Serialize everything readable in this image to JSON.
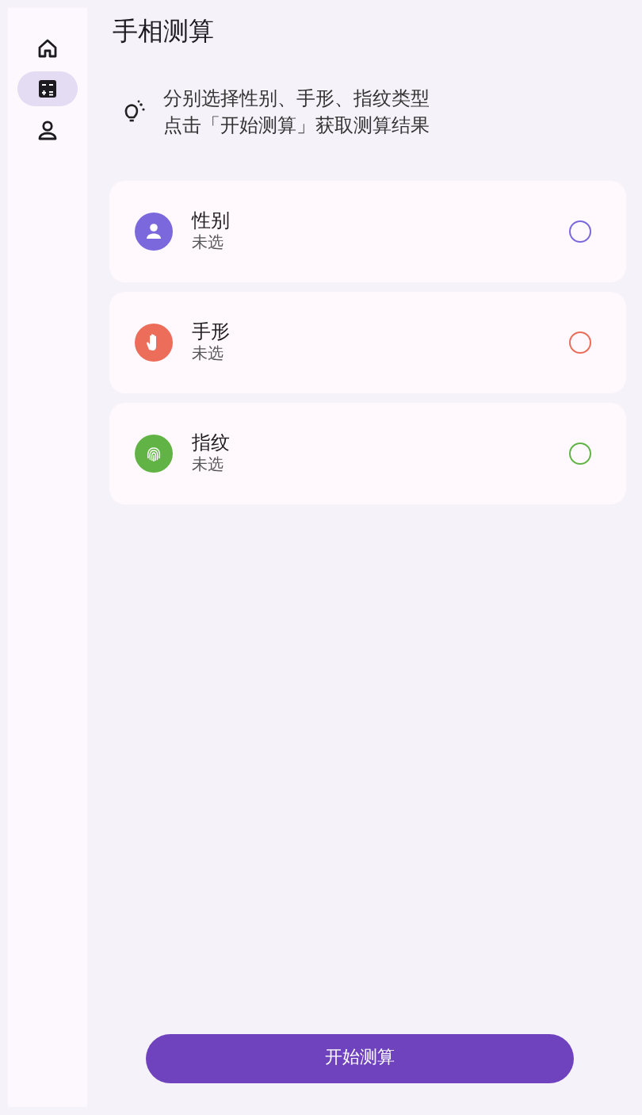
{
  "nav": [
    {
      "kind": "home",
      "selected": false
    },
    {
      "kind": "calculator",
      "selected": true
    },
    {
      "kind": "person",
      "selected": false
    }
  ],
  "title": "手相测算",
  "tip": {
    "lines": [
      "分别选择性别、手形、指纹类型",
      "点击「开始测算」获取测算结果"
    ]
  },
  "options": [
    {
      "kind": "person",
      "color": "#7b68dc",
      "title": "性别",
      "status": "未选",
      "selected": false
    },
    {
      "kind": "hand",
      "color": "#ec6d5a",
      "title": "手形",
      "status": "未选",
      "selected": false
    },
    {
      "kind": "fingerprint",
      "color": "#62b346",
      "title": "指纹",
      "status": "未选",
      "selected": false
    }
  ],
  "button": "开始测算"
}
